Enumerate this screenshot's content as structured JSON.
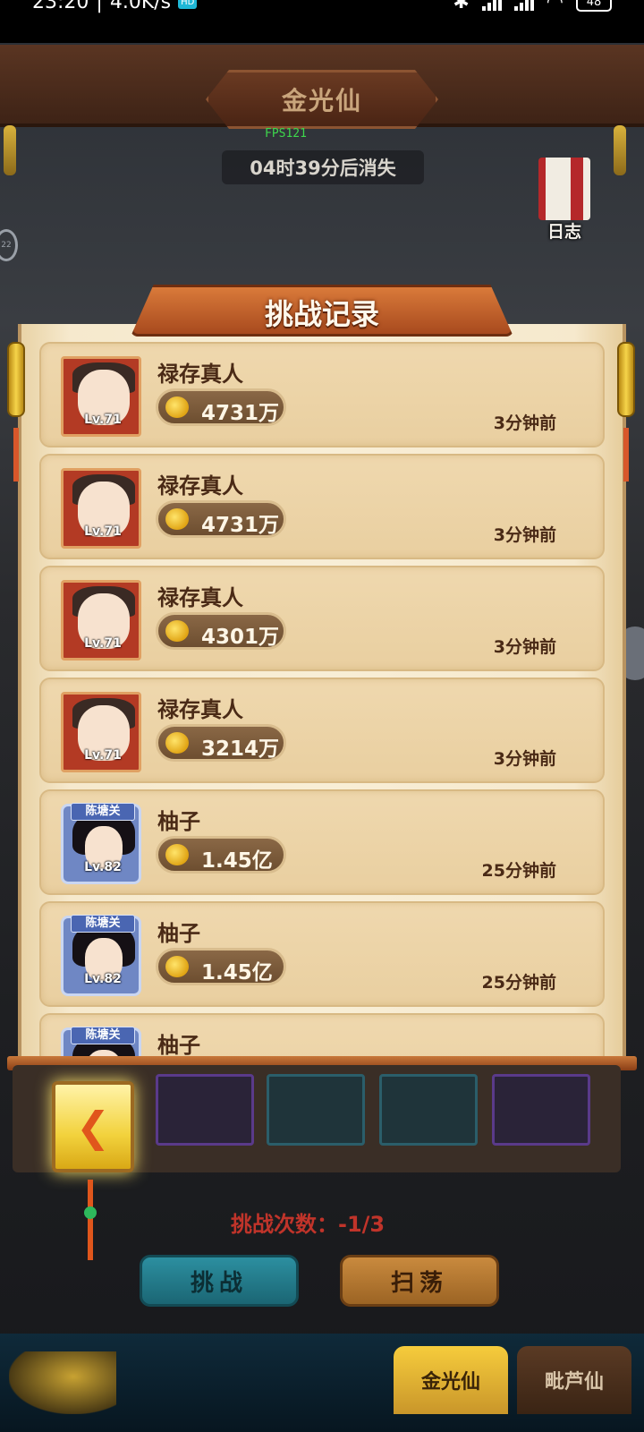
{
  "status_bar": {
    "time": "23:20",
    "speed": "4.0K/s",
    "speed_badge": "HD",
    "battery": "48"
  },
  "header": {
    "title": "金光仙",
    "fps": "FPS121",
    "countdown": "04时39分后消失",
    "log_label": "日志"
  },
  "panel": {
    "title": "挑战记录",
    "records": [
      {
        "name": "禄存真人",
        "level": "Lv.71",
        "power": "4731万",
        "time": "3分钟前",
        "style": "red",
        "faction": ""
      },
      {
        "name": "禄存真人",
        "level": "Lv.71",
        "power": "4731万",
        "time": "3分钟前",
        "style": "red",
        "faction": ""
      },
      {
        "name": "禄存真人",
        "level": "Lv.71",
        "power": "4301万",
        "time": "3分钟前",
        "style": "red",
        "faction": ""
      },
      {
        "name": "禄存真人",
        "level": "Lv.71",
        "power": "3214万",
        "time": "3分钟前",
        "style": "red",
        "faction": ""
      },
      {
        "name": "柚子",
        "level": "Lv.82",
        "power": "1.45亿",
        "time": "25分钟前",
        "style": "blue",
        "faction": "陈塘关"
      },
      {
        "name": "柚子",
        "level": "Lv.82",
        "power": "1.45亿",
        "time": "25分钟前",
        "style": "blue",
        "faction": "陈塘关"
      },
      {
        "name": "柚子",
        "level": "",
        "power": "",
        "time": "",
        "style": "blue",
        "faction": "陈塘关"
      }
    ]
  },
  "footer": {
    "challenge_count": "挑战次数：-1/3",
    "challenge_button": "挑战",
    "sweep_button": "扫荡",
    "back_glyph": "❮",
    "tabs": [
      {
        "label": "金光仙",
        "active": true
      },
      {
        "label": "毗芦仙",
        "active": false
      }
    ]
  }
}
